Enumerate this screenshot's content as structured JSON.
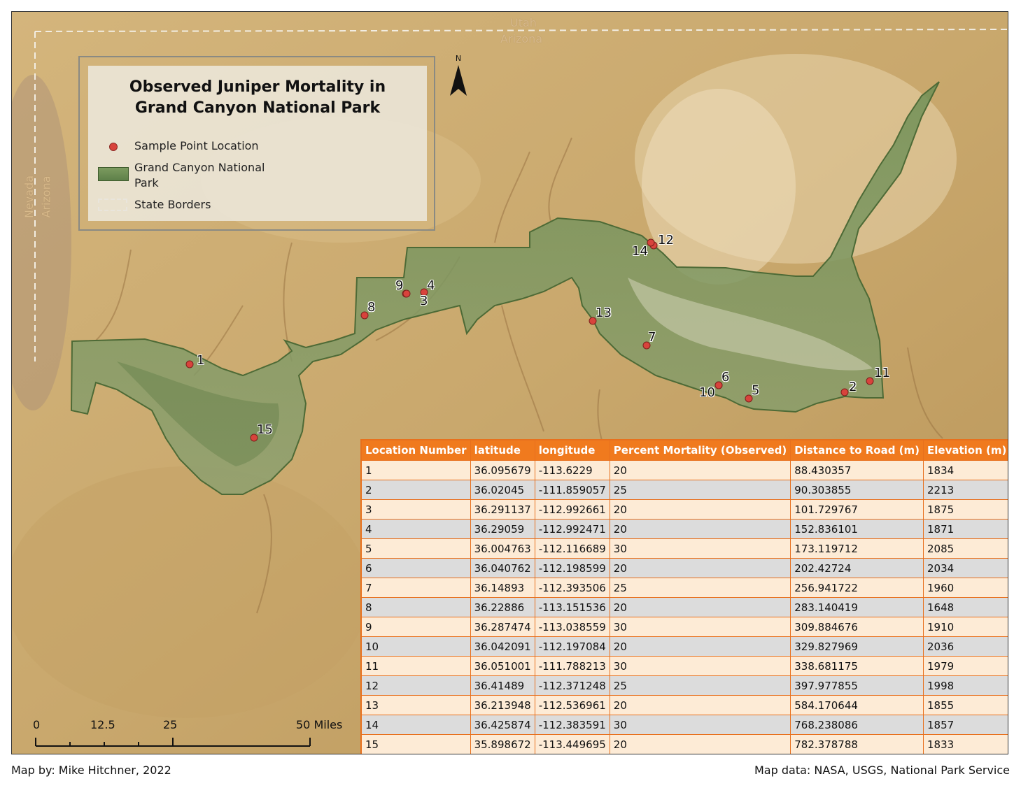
{
  "state_labels": {
    "utah": "Utah",
    "arizona_north": "Arizona",
    "nevada": "Nevada",
    "arizona_west": "Arizona"
  },
  "legend": {
    "title": "Observed Juniper Mortality in Grand Canyon National Park",
    "items": [
      {
        "symbol": "red-dot",
        "label": "Sample Point Location"
      },
      {
        "symbol": "green-polygon",
        "label": "Grand Canyon National Park"
      },
      {
        "symbol": "dashed-line",
        "label": "State Borders"
      }
    ]
  },
  "north_arrow": {
    "label": "N"
  },
  "points": [
    "1",
    "2",
    "3",
    "4",
    "5",
    "6",
    "7",
    "8",
    "9",
    "10",
    "11",
    "12",
    "13",
    "14",
    "15"
  ],
  "table": {
    "headers": [
      "Location Number",
      "latitude",
      "longitude",
      "Percent Mortality (Observed)",
      "Distance to Road (m)",
      "Elevation (m)"
    ],
    "rows": [
      [
        "1",
        "36.095679",
        "-113.6229",
        "20",
        "88.430357",
        "1834"
      ],
      [
        "2",
        "36.02045",
        "-111.859057",
        "25",
        "90.303855",
        "2213"
      ],
      [
        "3",
        "36.291137",
        "-112.992661",
        "20",
        "101.729767",
        "1875"
      ],
      [
        "4",
        "36.29059",
        "-112.992471",
        "20",
        "152.836101",
        "1871"
      ],
      [
        "5",
        "36.004763",
        "-112.116689",
        "30",
        "173.119712",
        "2085"
      ],
      [
        "6",
        "36.040762",
        "-112.198599",
        "20",
        "202.42724",
        "2034"
      ],
      [
        "7",
        "36.14893",
        "-112.393506",
        "25",
        "256.941722",
        "1960"
      ],
      [
        "8",
        "36.22886",
        "-113.151536",
        "20",
        "283.140419",
        "1648"
      ],
      [
        "9",
        "36.287474",
        "-113.038559",
        "30",
        "309.884676",
        "1910"
      ],
      [
        "10",
        "36.042091",
        "-112.197084",
        "20",
        "329.827969",
        "2036"
      ],
      [
        "11",
        "36.051001",
        "-111.788213",
        "30",
        "338.681175",
        "1979"
      ],
      [
        "12",
        "36.41489",
        "-112.371248",
        "25",
        "397.977855",
        "1998"
      ],
      [
        "13",
        "36.213948",
        "-112.536961",
        "20",
        "584.170644",
        "1855"
      ],
      [
        "14",
        "36.425874",
        "-112.383591",
        "30",
        "768.238086",
        "1857"
      ],
      [
        "15",
        "35.898672",
        "-113.449695",
        "20",
        "782.378788",
        "1833"
      ]
    ]
  },
  "scale_bar": {
    "labels": [
      "0",
      "12.5",
      "25",
      "50 Miles"
    ]
  },
  "credits": {
    "left": "Map by: Mike Hitchner, 2022",
    "right": "Map data: NASA, USGS, National Park Service"
  },
  "colors": {
    "park_fill": "#6f8f55",
    "point": "#d8433c",
    "table_header": "#f07a1e",
    "terrain": "#c8a56a"
  }
}
